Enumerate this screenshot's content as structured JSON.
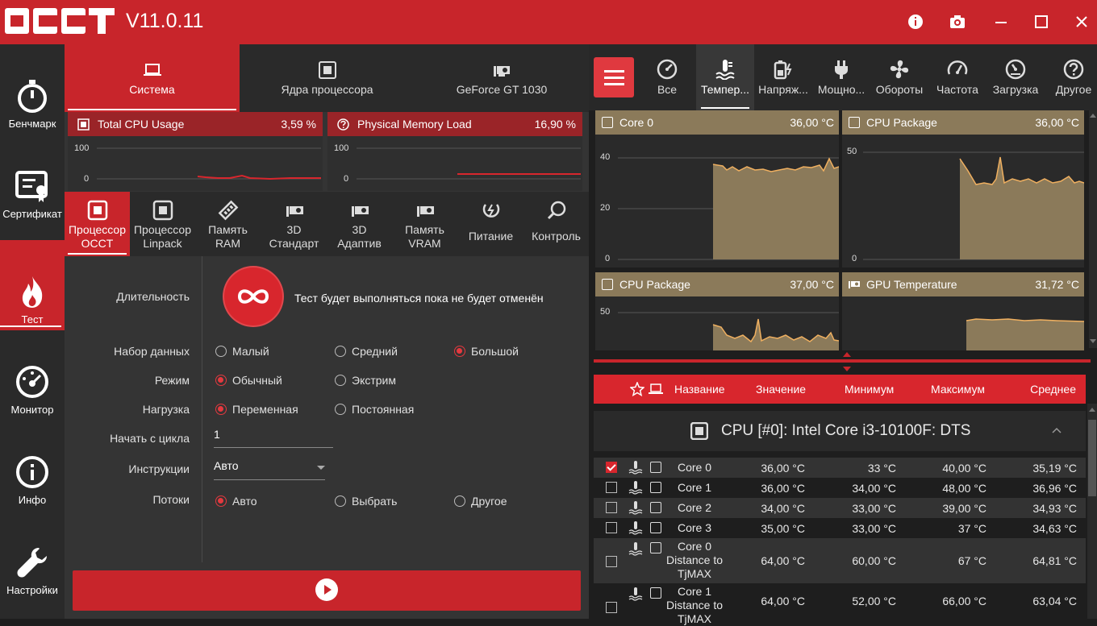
{
  "app": {
    "version": "V11.0.11",
    "logo_text": "OCCT"
  },
  "titlebar": {
    "icons": [
      "info-icon",
      "camera-icon",
      "minimize-icon",
      "maximize-icon",
      "close-icon"
    ]
  },
  "sidebar": {
    "items": [
      {
        "label": "Бенчмарк",
        "icon": "stopwatch-icon"
      },
      {
        "label": "Сертификат",
        "icon": "certificate-icon"
      },
      {
        "label": "Тест",
        "icon": "flame-icon",
        "active": true
      },
      {
        "label": "Монитор",
        "icon": "gauge-icon"
      },
      {
        "label": "Инфо",
        "icon": "info-icon"
      },
      {
        "label": "Настройки",
        "icon": "wrench-icon"
      }
    ]
  },
  "section_tabs": [
    {
      "label": "Система",
      "icon": "laptop-icon",
      "active": true
    },
    {
      "label": "Ядра процессора",
      "icon": "chip-icon"
    },
    {
      "label": "GeForce GT 1030",
      "icon": "gpu-icon"
    }
  ],
  "mini_graphs": [
    {
      "name": "Total CPU Usage",
      "value": "3,59 %",
      "y_max": "100",
      "y_min": "0"
    },
    {
      "name": "Physical Memory Load",
      "value": "16,90 %",
      "y_max": "100",
      "y_min": "0"
    }
  ],
  "test_tabs": [
    {
      "line1": "Процессор",
      "line2": "OCCT",
      "active": true
    },
    {
      "line1": "Процессор",
      "line2": "Linpack"
    },
    {
      "line1": "Память",
      "line2": "RAM"
    },
    {
      "line1": "3D",
      "line2": "Стандарт"
    },
    {
      "line1": "3D",
      "line2": "Адаптив"
    },
    {
      "line1": "Память",
      "line2": "VRAM"
    },
    {
      "line1": "Питание",
      "line2": ""
    },
    {
      "line1": "Контроль",
      "line2": ""
    }
  ],
  "form": {
    "duration_label": "Длительность",
    "duration_text": "Тест будет выполняться пока не будет отменён",
    "dataset_label": "Набор данных",
    "dataset_options": [
      "Малый",
      "Средний",
      "Большой"
    ],
    "dataset_selected": 2,
    "mode_label": "Режим",
    "mode_options": [
      "Обычный",
      "Экстрим"
    ],
    "mode_selected": 0,
    "load_label": "Нагрузка",
    "load_options": [
      "Переменная",
      "Постоянная"
    ],
    "load_selected": 0,
    "start_cycle_label": "Начать с цикла",
    "start_cycle_value": "1",
    "instructions_label": "Инструкции",
    "instructions_value": "Авто",
    "threads_label": "Потоки",
    "threads_options": [
      "Авто",
      "Выбрать",
      "Другое"
    ],
    "threads_selected": 0
  },
  "right_tabs": [
    {
      "label": "Все",
      "icon": "gauge-icon"
    },
    {
      "label": "Темпер...",
      "icon": "thermometer-icon",
      "active": true
    },
    {
      "label": "Напряж...",
      "icon": "battery-icon"
    },
    {
      "label": "Мощно...",
      "icon": "plug-icon"
    },
    {
      "label": "Обороты",
      "icon": "fan-icon"
    },
    {
      "label": "Частота",
      "icon": "speedometer-icon"
    },
    {
      "label": "Загрузка",
      "icon": "load-icon"
    },
    {
      "label": "Другое",
      "icon": "question-icon"
    }
  ],
  "graphs": [
    {
      "name": "Core 0",
      "value": "36,00 °C",
      "ticks": [
        "40",
        "20",
        "0"
      ]
    },
    {
      "name": "CPU Package",
      "value": "36,00 °C",
      "ticks": [
        "50",
        "0"
      ]
    },
    {
      "name": "CPU Package",
      "value": "37,00 °C",
      "ticks": [
        "50"
      ]
    },
    {
      "name": "GPU Temperature",
      "value": "31,72 °C",
      "ticks": []
    }
  ],
  "table": {
    "headers": {
      "name": "Название",
      "value": "Значение",
      "min": "Минимум",
      "max": "Максимум",
      "avg": "Среднее"
    },
    "group": "CPU [#0]: Intel Core i3-10100F: DTS",
    "rows": [
      {
        "name": "Core 0",
        "value": "36,00 °C",
        "min": "33 °C",
        "max": "40,00 °C",
        "avg": "35,19 °C",
        "checked": true
      },
      {
        "name": "Core 1",
        "value": "36,00 °C",
        "min": "34,00 °C",
        "max": "48,00 °C",
        "avg": "36,96 °C"
      },
      {
        "name": "Core 2",
        "value": "34,00 °C",
        "min": "33,00 °C",
        "max": "39,00 °C",
        "avg": "34,93 °C"
      },
      {
        "name": "Core 3",
        "value": "35,00 °C",
        "min": "33,00 °C",
        "max": "37 °C",
        "avg": "34,63 °C"
      },
      {
        "name": "Core 0 Distance to TjMAX",
        "value": "64,00 °C",
        "min": "60,00 °C",
        "max": "67 °C",
        "avg": "64,81 °C"
      },
      {
        "name": "Core 1 Distance to TjMAX",
        "value": "64,00 °C",
        "min": "52,00 °C",
        "max": "66,00 °C",
        "avg": "63,04 °C"
      }
    ]
  },
  "colors": {
    "accent": "#c8252b",
    "graph_fill": "#8b7a5a",
    "graph_line": "#f0b060"
  }
}
